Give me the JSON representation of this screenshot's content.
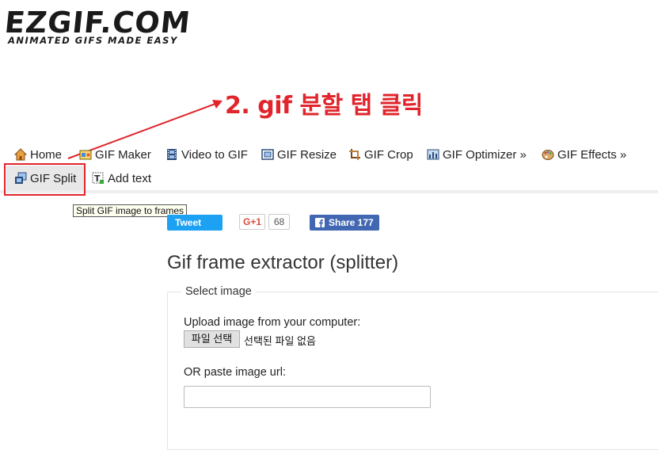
{
  "logo": {
    "main": "EZGIF.COM",
    "tagline": "ANIMATED GIFS MADE EASY"
  },
  "annotation": {
    "text": "2. gif 분할 탭 클릭",
    "color": "#e0252c"
  },
  "nav": {
    "items": [
      {
        "label": "Home",
        "icon": "home-icon"
      },
      {
        "label": "GIF Maker",
        "icon": "gif-maker-icon"
      },
      {
        "label": "Video to GIF",
        "icon": "film-icon"
      },
      {
        "label": "GIF Resize",
        "icon": "resize-icon"
      },
      {
        "label": "GIF Crop",
        "icon": "crop-icon"
      },
      {
        "label": "GIF Optimizer »",
        "icon": "optimizer-icon"
      },
      {
        "label": "GIF Effects »",
        "icon": "palette-icon"
      },
      {
        "label": "GIF Split",
        "icon": "split-icon"
      },
      {
        "label": "Add text",
        "icon": "text-icon"
      }
    ],
    "tooltip": "Split GIF image to frames"
  },
  "social": {
    "tweet_label": "Tweet",
    "gplus_label": "G+1",
    "gplus_count": "68",
    "facebook_label": "Share 177"
  },
  "main": {
    "title": "Gif frame extractor (splitter)",
    "legend": "Select image",
    "upload_label": "Upload image from your computer:",
    "file_button": "파일 선택",
    "file_status": "선택된 파일 없음",
    "url_label": "OR paste image url:",
    "url_value": ""
  },
  "colors": {
    "tweet": "#1da1f2",
    "facebook": "#4267b2",
    "gplus": "#dd4b39",
    "highlight": "#e0252c"
  }
}
